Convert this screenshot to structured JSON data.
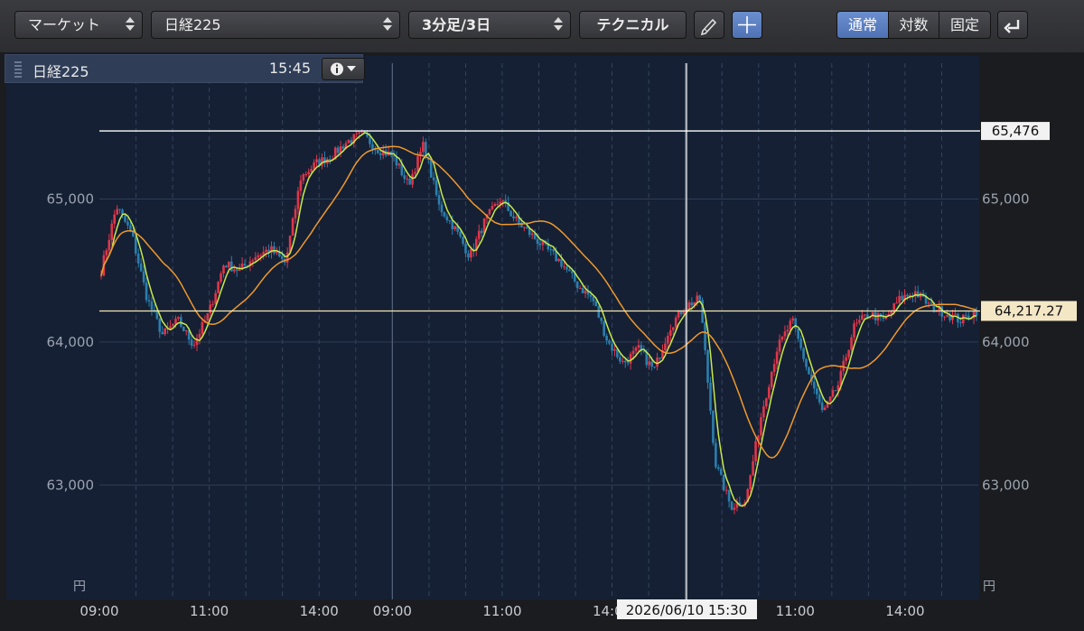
{
  "toolbar": {
    "market_select": "マーケット",
    "symbol_select": "日経225",
    "period_select": "3分足/3日",
    "technical_button": "テクニカル",
    "scale_modes": [
      "通常",
      "対数",
      "固定"
    ],
    "active_scale_mode": "通常"
  },
  "chart_header": {
    "symbol": "日経225",
    "time": "15:45"
  },
  "chart_data": {
    "type": "candlestick",
    "y_unit": "円",
    "y_ticks": [
      "63,000",
      "64,000",
      "65,000"
    ],
    "x_ticks": [
      "09:00",
      "11:00",
      "14:00",
      "09:00",
      "11:00",
      "14:00",
      "09:00",
      "11:00",
      "14:00"
    ],
    "crosshair_date_label": "2026/06/10 15:30",
    "high_line_label": "65,476",
    "current_price_label": "64,217.27",
    "ylim": [
      62200,
      65950
    ],
    "colors": {
      "up": "#e0364a",
      "down": "#2b7fae",
      "ma_short": "#c7ea4a",
      "ma_long": "#f0992c"
    },
    "price_path": [
      [
        0,
        64500
      ],
      [
        1,
        64950
      ],
      [
        2,
        64750
      ],
      [
        3,
        64300
      ],
      [
        4,
        64050
      ],
      [
        5,
        64150
      ],
      [
        6,
        63980
      ],
      [
        7,
        64200
      ],
      [
        8,
        64550
      ],
      [
        9,
        64500
      ],
      [
        10,
        64600
      ],
      [
        11,
        64650
      ],
      [
        12,
        64550
      ],
      [
        13,
        65150
      ],
      [
        14,
        65250
      ],
      [
        15,
        65300
      ],
      [
        16,
        65400
      ],
      [
        17,
        65450
      ],
      [
        18,
        65350
      ],
      [
        19,
        65300
      ],
      [
        20,
        65100
      ],
      [
        21,
        65380
      ],
      [
        22,
        64950
      ],
      [
        23,
        64800
      ],
      [
        24,
        64600
      ],
      [
        25,
        64850
      ],
      [
        26,
        65000
      ],
      [
        27,
        64850
      ],
      [
        28,
        64750
      ],
      [
        29,
        64650
      ],
      [
        30,
        64550
      ],
      [
        31,
        64400
      ],
      [
        32,
        64300
      ],
      [
        33,
        64000
      ],
      [
        34,
        63850
      ],
      [
        35,
        63950
      ],
      [
        36,
        63800
      ],
      [
        37,
        64100
      ],
      [
        38,
        64250
      ],
      [
        39,
        64300
      ],
      [
        40,
        63150
      ],
      [
        41,
        62850
      ],
      [
        42,
        62900
      ],
      [
        43,
        63500
      ],
      [
        44,
        63950
      ],
      [
        45,
        64150
      ],
      [
        46,
        63800
      ],
      [
        47,
        63500
      ],
      [
        48,
        63700
      ],
      [
        49,
        64100
      ],
      [
        50,
        64200
      ],
      [
        51,
        64150
      ],
      [
        52,
        64300
      ],
      [
        53,
        64350
      ],
      [
        54,
        64250
      ],
      [
        55,
        64200
      ],
      [
        56,
        64150
      ],
      [
        57,
        64217
      ]
    ]
  }
}
